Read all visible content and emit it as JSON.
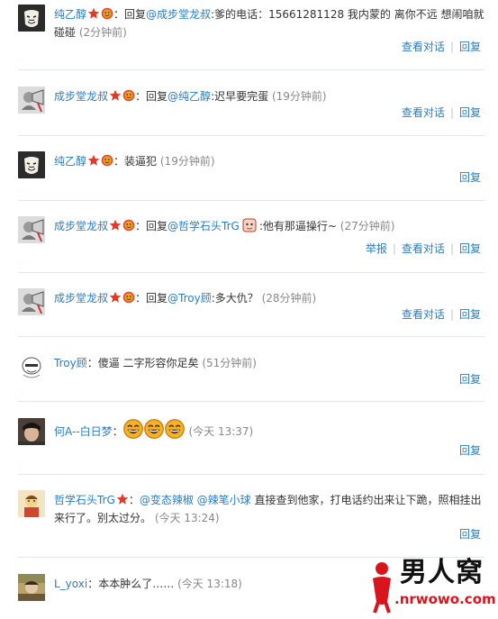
{
  "labels": {
    "reply": "回复",
    "view_conversation": "查看对话",
    "report": "举报",
    "colon": "："
  },
  "colors": {
    "link": "#2b7dbc",
    "time": "#888888",
    "separator": "#dde9ef",
    "star": "#e03a2b",
    "face": "#f4a21a"
  },
  "comments": [
    {
      "author": "纯乙醇",
      "avatar": "mask-avatar",
      "badges": [
        "star",
        "face"
      ],
      "prefix": "回复",
      "mention": "@成步堂龙叔",
      "text": ":爹的电话：15661281128 我内蒙的 离你不远 想闹咱就碰碰",
      "time": "(2分钟前)",
      "actions": [
        "查看对话",
        "回复"
      ]
    },
    {
      "author": "成步堂龙叔",
      "avatar": "lawyer-avatar",
      "badges": [
        "star",
        "face"
      ],
      "prefix": "回复",
      "mention": "@纯乙醇",
      "text": ":迟早要完蛋",
      "time": "(19分钟前)",
      "actions": [
        "查看对话",
        "回复"
      ]
    },
    {
      "author": "纯乙醇",
      "avatar": "mask-avatar",
      "badges": [
        "star",
        "face"
      ],
      "prefix": "",
      "mention": "",
      "text": "装逼犯",
      "time": "(19分钟前)",
      "actions": [
        "回复"
      ]
    },
    {
      "author": "成步堂龙叔",
      "avatar": "lawyer-avatar",
      "badges": [
        "star",
        "face"
      ],
      "prefix": "回复",
      "mention": "@哲学石头TrG",
      "text": ":他有那逼操行~",
      "time": "(27分钟前)",
      "actions": [
        "举报",
        "查看对话",
        "回复"
      ]
    },
    {
      "author": "成步堂龙叔",
      "avatar": "lawyer-avatar",
      "badges": [
        "star",
        "face"
      ],
      "prefix": "回复",
      "mention": "@Troy顾",
      "text": ":多大仇？",
      "time": "(28分钟前)",
      "actions": [
        "查看对话",
        "回复"
      ]
    },
    {
      "author": "Troy顾",
      "avatar": "meme-avatar",
      "badges": [],
      "prefix": "",
      "mention": "",
      "text": "傻逼 二字形容你足矣",
      "time": "(51分钟前)",
      "actions": [
        "回复"
      ]
    },
    {
      "author": "何A--白日梦",
      "avatar": "boy-avatar",
      "badges": [],
      "prefix": "",
      "mention": "",
      "text": "",
      "time": "(今天 13:37)",
      "actions": [
        "回复"
      ]
    },
    {
      "author": "哲学石头TrG",
      "avatar": "cartoon-avatar",
      "badges": [
        "star"
      ],
      "prefix": "",
      "mention": "@变态辣椒 @辣笔小球",
      "text": " 直接查到他家，打电话约出来让下跪，照相挂出来行了。别太过分。",
      "time": "(今天 13:24)",
      "actions": [
        "回复"
      ]
    },
    {
      "author": "L_yoxi",
      "avatar": "photo-avatar",
      "badges": [],
      "prefix": "",
      "mention": "",
      "text": "本本肿么了……",
      "time": "(今天 13:18)",
      "actions": []
    }
  ],
  "watermark": {
    "brand": "男人窝",
    "url": ".nrwowo.com"
  }
}
